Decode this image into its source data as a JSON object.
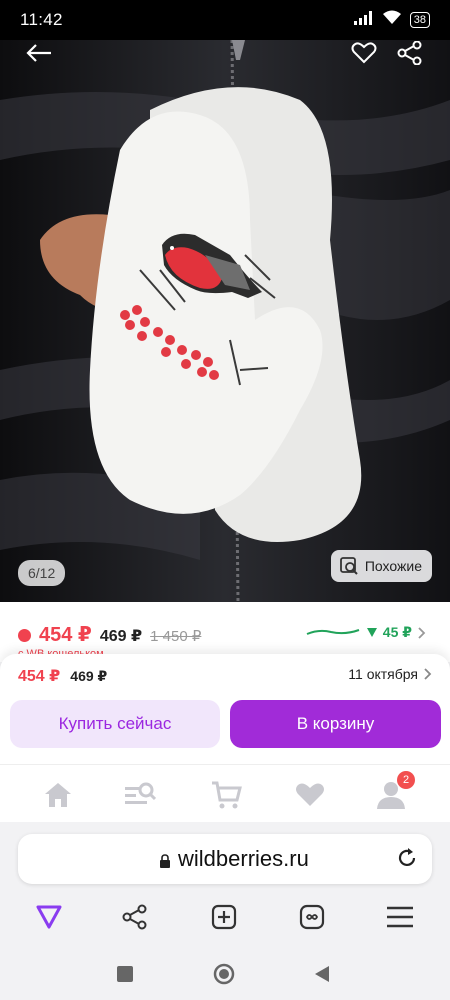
{
  "status": {
    "time": "11:42",
    "battery": "38"
  },
  "photo": {
    "counter": "6/12",
    "similar_label": "Похожие",
    "icons": [
      "back-arrow-icon",
      "heart-icon",
      "share-icon"
    ]
  },
  "price": {
    "current": "454 ₽",
    "wallet": "469 ₽",
    "old": "1 450 ₽",
    "drop": "45 ₽",
    "note": "с WB кошельком"
  },
  "buy_sheet": {
    "price_current": "454 ₽",
    "price_wallet": "469 ₽",
    "delivery_date": "11 октября",
    "buy_now_label": "Купить сейчас",
    "add_to_cart_label": "В корзину"
  },
  "tabbar": {
    "items": [
      "home-icon",
      "catalog-search-icon",
      "cart-icon",
      "favorites-icon",
      "profile-icon"
    ],
    "profile_badge": "2"
  },
  "browser": {
    "url": "wildberries.ru",
    "buttons": [
      "alice-icon",
      "share-icon",
      "new-tab-icon",
      "tabs-icon",
      "menu-icon"
    ]
  },
  "colors": {
    "accent": "#a12bd8",
    "price_red": "#f0424f",
    "price_drop_green": "#21a35a"
  }
}
